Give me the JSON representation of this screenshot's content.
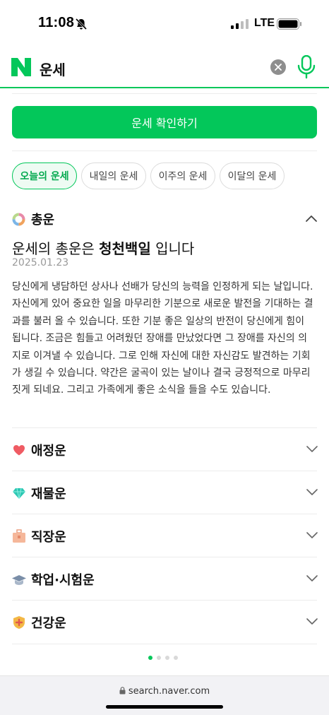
{
  "status_bar": {
    "time": "11:08",
    "network": "LTE"
  },
  "search": {
    "query": "운세"
  },
  "cta": {
    "label": "운세 확인하기"
  },
  "tabs": [
    {
      "label": "오늘의 운세",
      "active": true
    },
    {
      "label": "내일의 운세",
      "active": false
    },
    {
      "label": "이주의 운세",
      "active": false
    },
    {
      "label": "이달의 운세",
      "active": false
    }
  ],
  "general": {
    "title": "총운",
    "headline_pre": "운세의 총운은 ",
    "headline_strong": "청천백일",
    "headline_post": " 입니다",
    "date": "2025.01.23",
    "text": "당신에게 냉담하던 상사나 선배가 당신의 능력을 인정하게 되는 날입니다. 자신에게 있어 중요한 일을 마무리한 기분으로 새로운 발전을 기대하는 결과를 불러 올 수 있습니다. 또한 기분 좋은 일상의 반전이 당신에게 힘이 됩니다. 조금은 힘들고 어려웠던 장애를 만났었다면 그 장애를 자신의 의지로 이겨낼 수 있습니다. 그로 인해 자신에 대한 자신감도 발견하는 기회가 생길 수 있습니다. 약간은 굴곡이 있는 날이나 결국 긍정적으로 마무리 짓게 되네요. 그리고 가족에게 좋은 소식을 들을 수도 있습니다."
  },
  "categories": [
    {
      "label": "애정운",
      "icon": "heart-icon"
    },
    {
      "label": "재물운",
      "icon": "gem-icon"
    },
    {
      "label": "직장운",
      "icon": "briefcase-icon"
    },
    {
      "label": "학업·시험운",
      "icon": "graduation-cap-icon"
    },
    {
      "label": "건강운",
      "icon": "health-shield-icon"
    }
  ],
  "pagination": {
    "total": 4,
    "current": 1
  },
  "browser": {
    "url": "search.naver.com"
  },
  "colors": {
    "brand": "#03c75a",
    "text": "#222222",
    "muted": "#999999"
  }
}
